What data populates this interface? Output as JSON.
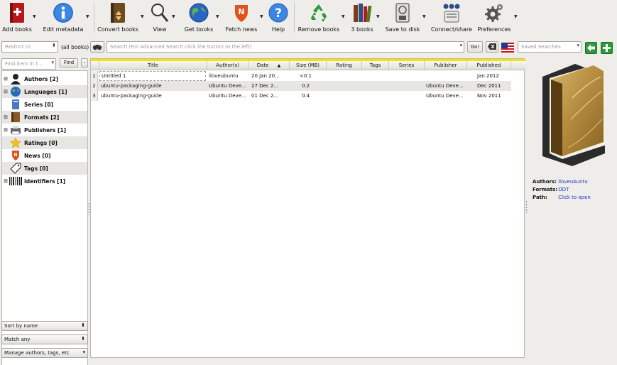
{
  "toolbar": {
    "add_books": "Add books",
    "edit_metadata": "Edit metadata",
    "convert_books": "Convert books",
    "view": "View",
    "get_books": "Get books",
    "fetch_news": "Fetch news",
    "help": "Help",
    "remove_books": "Remove books",
    "books_count": "3 books",
    "save_to_disk": "Save to disk",
    "connect_share": "Connect/share",
    "preferences": "Preferences"
  },
  "search": {
    "restrict_placeholder": "Restrict to",
    "all_books": "(all books)",
    "placeholder": "Search (For Advanced Search click the button to the left)",
    "go": "Go!",
    "saved_searches_placeholder": "Saved Searches"
  },
  "tag_browser": {
    "find_placeholder": "Find item in t...",
    "find_button": "Find",
    "minus": "-",
    "items": [
      {
        "label": "Authors [2]",
        "expand": "⊞",
        "icon": "person-icon"
      },
      {
        "label": "Languages [1]",
        "expand": "⊞",
        "icon": "globe-icon"
      },
      {
        "label": "Series [0]",
        "expand": "",
        "icon": "series-icon"
      },
      {
        "label": "Formats [2]",
        "expand": "⊞",
        "icon": "book-icon"
      },
      {
        "label": "Publishers [1]",
        "expand": "⊞",
        "icon": "publisher-icon"
      },
      {
        "label": "Ratings [0]",
        "expand": "",
        "icon": "star-icon"
      },
      {
        "label": "News [0]",
        "expand": "",
        "icon": "news-icon"
      },
      {
        "label": "Tags [0]",
        "expand": "",
        "icon": "tag-icon"
      },
      {
        "label": "Identifiers [1]",
        "expand": "⊞",
        "icon": "barcode-icon"
      }
    ],
    "sort_by": "Sort by name",
    "match": "Match any",
    "manage": "Manage authors, tags, etc"
  },
  "table": {
    "columns": [
      "Title",
      "Author(s)",
      "Date",
      "Size (MB)",
      "Rating",
      "Tags",
      "Series",
      "Publisher",
      "Published"
    ],
    "sort_indicator": "▲",
    "rows": [
      {
        "num": "1",
        "title": "Untitled 1",
        "author": "iloveubuntu",
        "date": "20 Jan 20...",
        "size": "<0.1",
        "rating": "",
        "tags": "",
        "series": "",
        "publisher": "",
        "published": "Jan 2012"
      },
      {
        "num": "2",
        "title": "ubuntu-packaging-guide",
        "author": "Ubuntu Deve...",
        "date": "27 Dec 2...",
        "size": "0.2",
        "rating": "",
        "tags": "",
        "series": "",
        "publisher": "Ubuntu Deve...",
        "published": "Dec 2011"
      },
      {
        "num": "3",
        "title": "ubuntu-packaging-guide",
        "author": "Ubuntu Deve...",
        "date": "01 Dec 2...",
        "size": "0.4",
        "rating": "",
        "tags": "",
        "series": "",
        "publisher": "Ubuntu Deve...",
        "published": "Nov 2011"
      }
    ]
  },
  "book_details": {
    "authors_label": "Authors:",
    "authors_value": "iloveubuntu",
    "formats_label": "Formats:",
    "formats_value": "ODT",
    "path_label": "Path:",
    "path_value": "Click to open"
  },
  "colors": {
    "accent_yellow": "#f2e500",
    "link_blue": "#1e35c9",
    "alt_row": "#e8e6e3"
  }
}
